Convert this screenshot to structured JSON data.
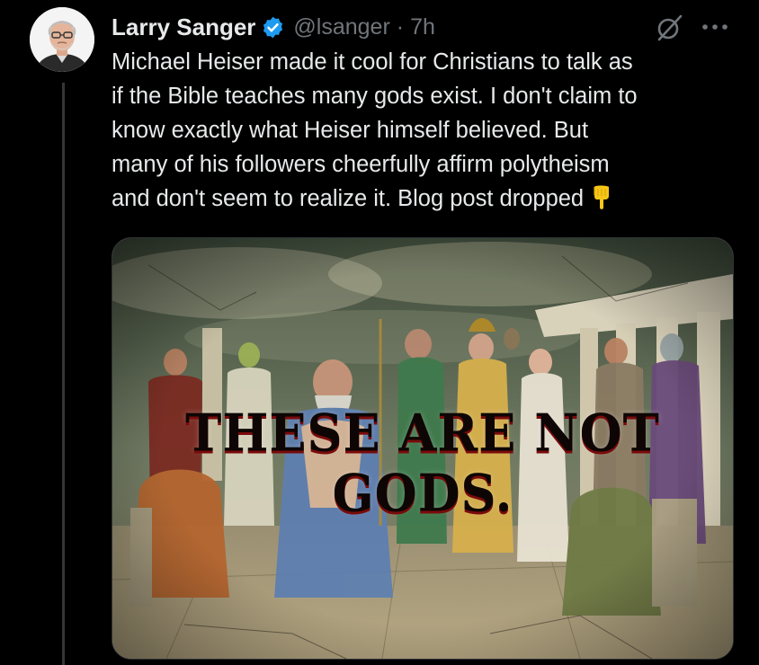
{
  "author": {
    "name": "Larry Sanger",
    "handle": "@lsanger",
    "separator": "·",
    "time": "7h",
    "verified": true,
    "avatar_icon": "avatar-portrait"
  },
  "tweet": {
    "text": "Michael Heiser made it cool for Christians to talk as\nif the Bible teaches many gods exist. I don't claim to\nknow exactly what Heiser himself believed. But\nmany of his followers cheerfully affirm polytheism\nand don't seem to realize it. Blog post dropped",
    "emoji": "backhand-index-pointing-down"
  },
  "media": {
    "overlay_text": "THESE ARE NOT GODS."
  },
  "icons": {
    "grok": "grok-icon",
    "more": "more-icon",
    "verified": "verified-badge-icon"
  },
  "colors": {
    "background": "#000000",
    "text": "#e7e9ea",
    "muted": "#71767b",
    "verified": "#1d9bf0",
    "thread_line": "#333639",
    "emoji_yellow": "#f5c518"
  }
}
